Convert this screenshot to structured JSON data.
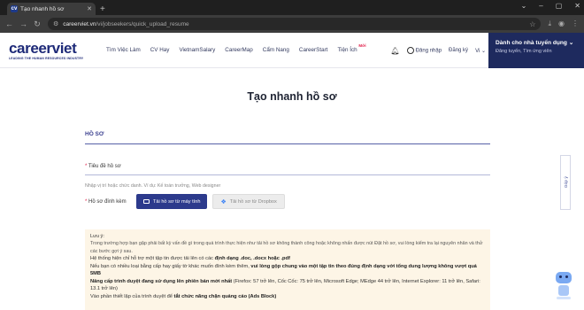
{
  "browser": {
    "tab_title": "Tạo nhanh hồ sơ",
    "tab_favicon": "cv",
    "url_host": "careerviet.vn",
    "url_path": "/vi/jobseekers/quick_upload_resume"
  },
  "header": {
    "logo_main": "careerviet",
    "logo_sub": "LEADING THE HUMAN RESOURCES INDUSTRY",
    "nav": [
      "Tìm Việc Làm",
      "CV Hay",
      "VietnamSalary",
      "CareerMap",
      "Cẩm Nang",
      "CareerStart",
      "Tiện Ích"
    ],
    "nav_badge": "Mới",
    "login": "Đăng nhập",
    "register": "Đăng ký",
    "lang": "Vi",
    "employer_title": "Dành cho nhà tuyển dụng",
    "employer_sub": "Đăng tuyển, Tìm ứng viên"
  },
  "page": {
    "title": "Tạo nhanh hồ sơ",
    "section_title": "HỒ SƠ",
    "field_label": "Tiêu đề hồ sơ",
    "required_mark": "*",
    "field_hint": "Nhập vị trí hoặc chức danh. Ví dụ: Kế toán trưởng, Web designer",
    "upload_label": "Hồ sơ đính kèm",
    "btn_computer": "Tải hồ sơ từ máy tính",
    "btn_dropbox": "Tải hồ sơ từ Dropbox"
  },
  "note": {
    "title": "Lưu ý:",
    "line1": "Trong trường hợp bạn gặp phải bất kỳ vấn đề gì trong quá trình thực hiện như tải hồ sơ không thành công hoặc không nhấn được nút Đặt hồ sơ, vui lòng kiểm tra lại nguyên nhân và thử các bước gợi ý sau.",
    "line2_a": "Hệ thống hiện chỉ hỗ trợ một tập tin được tải lên có các ",
    "line2_b": "định dạng .doc, .docx hoặc .pdf",
    "line3_a": "Nếu bạn có nhiều loại bằng cấp hay giấy tờ khác muốn đính kèm thêm, ",
    "line3_b": "vui lòng gộp chung vào một tập tin theo đúng định dạng với tổng dung lượng không vượt quá 5MB",
    "line4_a": "Nâng cấp trình duyệt đang sử dụng lên phiên bản mới nhất",
    "line4_b": " (Firefox: 57 trở lên, Cốc Cốc: 75 trở lên, Microsoft Edge; MEdge 44 trở lên, Internet Explorer: 11 trở lên, Safari: 13.1 trở lên)",
    "line5_a": "Vào phần thiết lập của trình duyệt để ",
    "line5_b": "tắt chức năng chặn quảng cáo (Ads Block)"
  },
  "feedback_label": "Góp ý"
}
